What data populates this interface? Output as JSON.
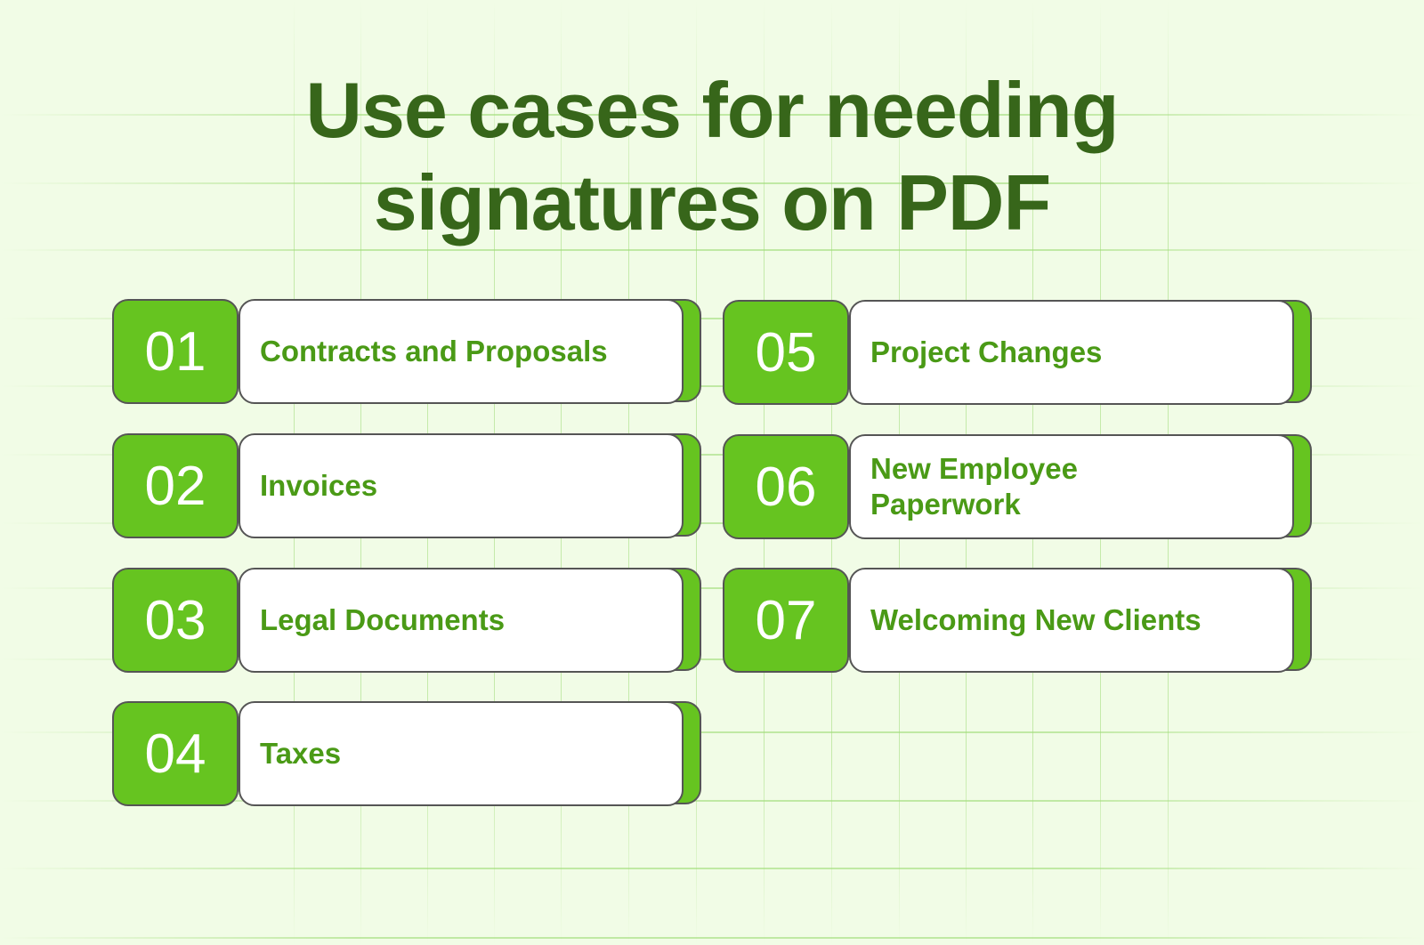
{
  "title": {
    "line1": "Use cases for needing",
    "line2": "signatures on PDF"
  },
  "colors": {
    "background": "#f1fce6",
    "title": "#37661a",
    "accent": "#66c420",
    "label_text": "#4a9a16",
    "number_text": "#ffffff"
  },
  "items": [
    {
      "number": "01",
      "label": "Contracts and Proposals"
    },
    {
      "number": "02",
      "label": "Invoices"
    },
    {
      "number": "03",
      "label": "Legal Documents"
    },
    {
      "number": "04",
      "label": "Taxes"
    },
    {
      "number": "05",
      "label": "Project Changes"
    },
    {
      "number": "06",
      "label": "New Employee Paperwork"
    },
    {
      "number": "07",
      "label": "Welcoming New Clients"
    }
  ]
}
